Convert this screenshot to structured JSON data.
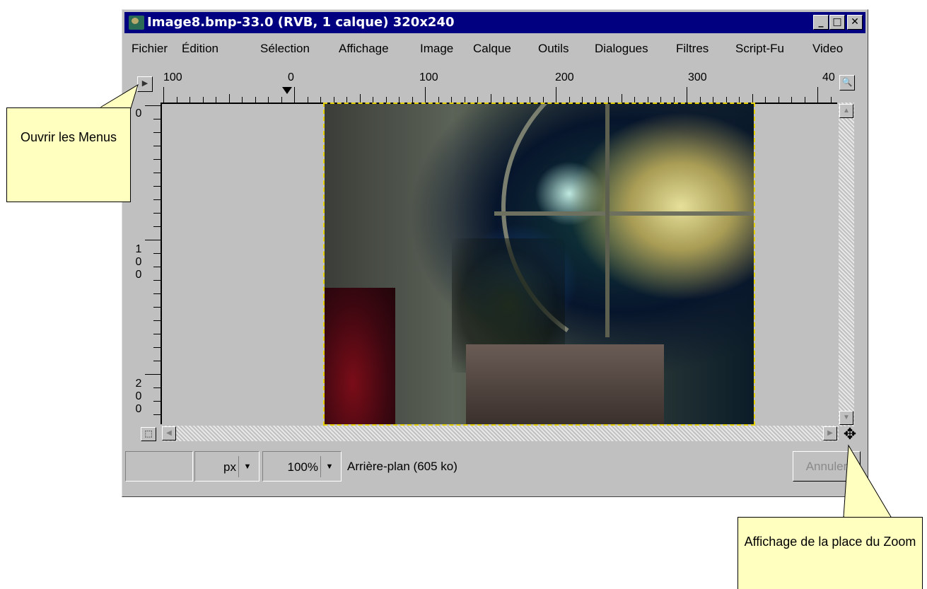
{
  "window": {
    "title": "Image8.bmp-33.0 (RVB, 1 calque) 320x240",
    "min_label": "_",
    "max_label": "□",
    "close_label": "✕"
  },
  "menu": [
    "Fichier",
    "Édition",
    "Sélection",
    "Affichage",
    "Image",
    "Calque",
    "Outils",
    "Dialogues",
    "Filtres",
    "Script-Fu",
    "Video"
  ],
  "ruler": {
    "h_labels": [
      "100",
      "0",
      "100",
      "200",
      "300",
      "40"
    ],
    "v_labels": [
      [
        "0"
      ],
      [
        "1",
        "0",
        "0"
      ],
      [
        "2",
        "0",
        "0"
      ]
    ]
  },
  "status": {
    "unit": "px",
    "zoom": "100%",
    "layer_info": "Arrière-plan (605 ko)",
    "cancel_label": "Annuler"
  },
  "callouts": {
    "menu": "Ouvrir les Menus",
    "zoom": "Affichage de la place du Zoom"
  },
  "icons": {
    "menu_button": "triangle-right-icon",
    "zoom_toggle": "magnifier-icon",
    "quick_mask": "quick-mask-icon",
    "navigate": "navigate-move-icon"
  },
  "colors": {
    "title_bar": "#000080",
    "window_face": "#c0c0c0",
    "callout_bg": "#ffffc0",
    "selection_marching_ants": "#e6d200"
  }
}
